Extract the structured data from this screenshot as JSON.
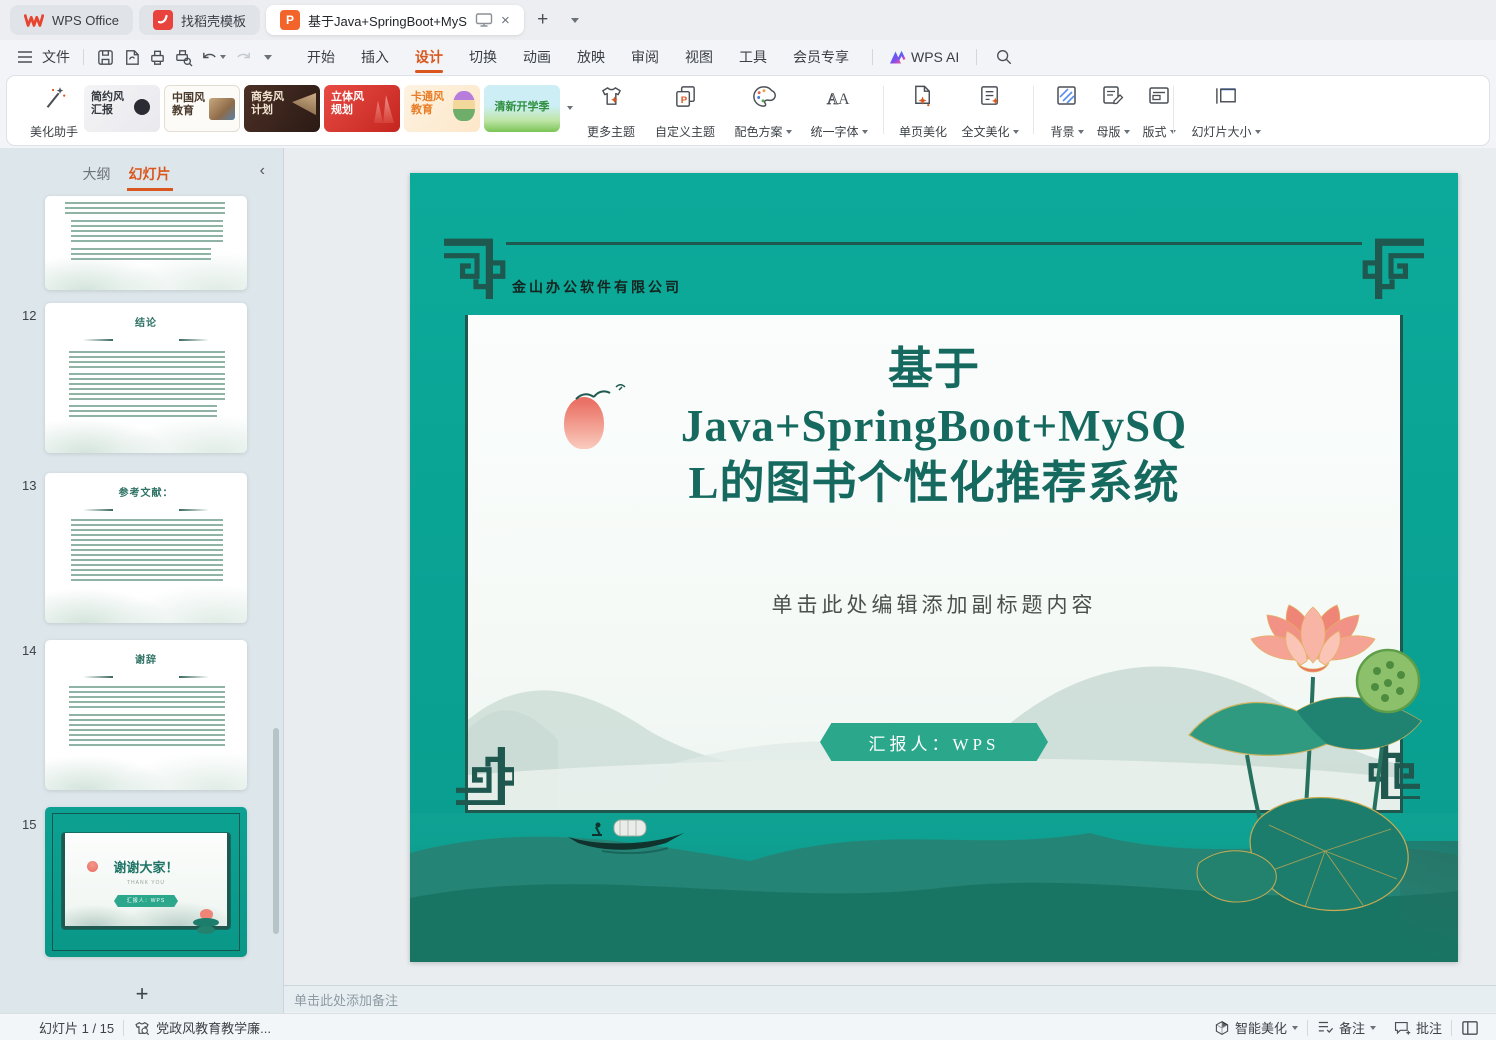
{
  "tab_bar": {
    "wps_label": "WPS Office",
    "docer_label": "找稻壳模板",
    "doc_label": "基于Java+SpringBoot+MyS"
  },
  "menu_bar": {
    "file": "文件",
    "items": [
      "开始",
      "插入",
      "设计",
      "切换",
      "动画",
      "放映",
      "审阅",
      "视图",
      "工具",
      "会员专享"
    ],
    "wps_ai": "WPS AI"
  },
  "ribbon": {
    "assistant": "美化助手",
    "templates": [
      {
        "line1": "简约风",
        "line2": "汇报"
      },
      {
        "line1": "中国风",
        "line2": "教育"
      },
      {
        "line1": "商务风",
        "line2": "计划"
      },
      {
        "line1": "立体风",
        "line2": "规划"
      },
      {
        "line1": "卡通风",
        "line2": "教育"
      },
      {
        "line1": "清新开学季",
        "line2": ""
      }
    ],
    "buttons": {
      "more_themes": "更多主题",
      "custom_theme": "自定义主题",
      "color_scheme": "配色方案",
      "unify_font": "统一字体",
      "beautify_page": "单页美化",
      "beautify_all": "全文美化",
      "background": "背景",
      "master": "母版",
      "layout": "版式",
      "slide_size": "幻灯片大小"
    }
  },
  "sidebar": {
    "tab_outline": "大纲",
    "tab_slides": "幻灯片",
    "slides": [
      {
        "number": "12",
        "title": "结论"
      },
      {
        "number": "13",
        "title": "参考文献："
      },
      {
        "number": "14",
        "title": "谢辞"
      },
      {
        "number": "15",
        "title": "谢谢大家！",
        "subtitle": "THANK YOU",
        "badge": "汇报人：WPS"
      }
    ]
  },
  "slide": {
    "company": "金山办公软件有限公司",
    "title_lines": [
      "基于",
      "Java+SpringBoot+MySQ",
      "L的图书个性化推荐系统"
    ],
    "subtitle": "单击此处编辑添加副标题内容",
    "badge": "汇报人：WPS"
  },
  "notes": {
    "placeholder": "单击此处添加备注"
  },
  "status_bar": {
    "slide_counter": "幻灯片 1 / 15",
    "template_name": "党政风教育教学廉...",
    "smart_beautify": "智能美化",
    "notes_label": "备注",
    "comments_label": "批注"
  },
  "colors": {
    "slide_teal": "#0aa996",
    "ornament_dark": "#1e584f",
    "title_teal": "#15695e",
    "accent_orange": "#d9571e",
    "badge_teal": "#2ba78c"
  }
}
